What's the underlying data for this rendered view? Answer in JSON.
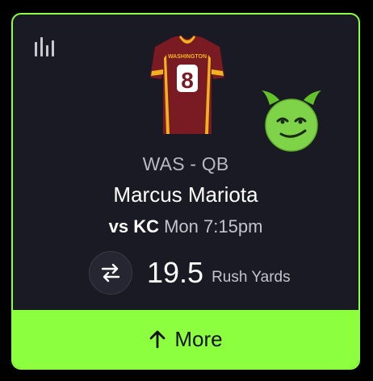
{
  "card": {
    "accent_color": "#8cff3e",
    "background_color": "#1a1a24",
    "stats_icon": "bar-chart-icon",
    "jersey": {
      "team_text": "WASHINGTON",
      "number": "8",
      "primary_color": "#7a1a22",
      "trim_color": "#f2b21e"
    },
    "emoji": "smiling-devil-emoji",
    "team_position": "WAS - QB",
    "player_name": "Marcus Mariota",
    "matchup": {
      "vs_label": "vs",
      "opponent": "KC",
      "game_time": "Mon 7:15pm"
    },
    "line": {
      "swap_icon": "swap-arrows-icon",
      "value": "19.5",
      "stat": "Rush Yards"
    },
    "more_button": {
      "icon": "arrow-up-icon",
      "label": "More"
    }
  }
}
